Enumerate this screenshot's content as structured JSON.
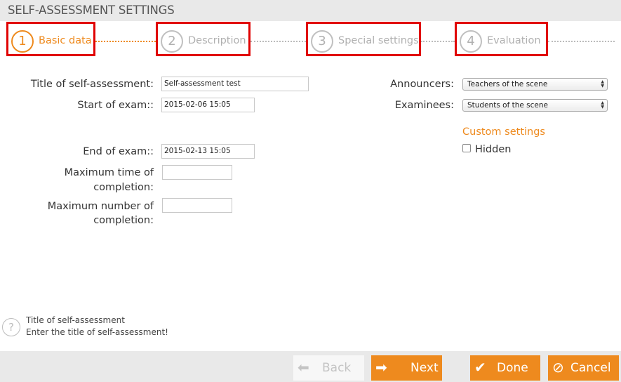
{
  "header": {
    "title": "SELF-ASSESSMENT SETTINGS"
  },
  "wizard": {
    "steps": [
      {
        "number": "1",
        "label": "Basic data",
        "active": true
      },
      {
        "number": "2",
        "label": "Description",
        "active": false
      },
      {
        "number": "3",
        "label": "Special settings",
        "active": false
      },
      {
        "number": "4",
        "label": "Evaluation",
        "active": false
      }
    ]
  },
  "form": {
    "title_label": "Title of self-assessment:",
    "title_value": "Self-assessment test",
    "start_label": "Start of exam::",
    "start_value": "2015-02-06 15:05",
    "end_label": "End of exam::",
    "end_value": "2015-02-13 15:05",
    "max_time_label_line1": "Maximum time of",
    "max_time_label_line2": "completion:",
    "max_time_value": "",
    "max_number_label_line1": "Maximum number of",
    "max_number_label_line2": "completion:",
    "max_number_value": "",
    "announcers_label": "Announcers:",
    "announcers_selected": "Teachers of the scene",
    "examinees_label": "Examinees:",
    "examinees_selected": "Students of the scene",
    "custom_settings_title": "Custom settings",
    "hidden_label": "Hidden",
    "hidden_checked": false
  },
  "help": {
    "icon": "question-icon",
    "title": "Title of self-assessment",
    "text": "Enter the title of self-assessment!"
  },
  "footer": {
    "back_label": "Back",
    "next_label": "Next",
    "done_label": "Done",
    "cancel_label": "Cancel"
  },
  "colors": {
    "accent": "#ee8a1e",
    "highlight_border": "#e00000",
    "disabled_text": "#c4c4c4"
  }
}
